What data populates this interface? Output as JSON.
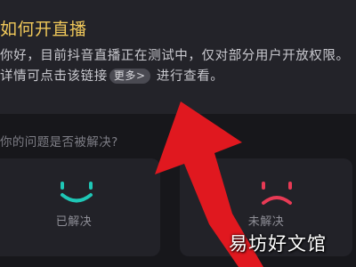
{
  "faq": {
    "title": "如何开直播",
    "answer_before_link": "你好，目前抖音直播正在测试中，仅对部分用户开放权限。详情可点击该链接",
    "more_link": "更多>",
    "answer_after_link": " 进行查看。"
  },
  "feedback": {
    "question": "你的问题是否被解决?",
    "solved": {
      "label": "已解决",
      "icon": "smile-icon",
      "color": "#1fc7b6"
    },
    "unsolved": {
      "label": "未解决",
      "icon": "frown-icon",
      "color": "#e83a55"
    }
  },
  "overlay": {
    "arrow_color": "#e0181f",
    "watermark": "易坊好文馆"
  },
  "colors": {
    "background": "#17171b",
    "card": "#232329",
    "title": "#f0c85a"
  }
}
